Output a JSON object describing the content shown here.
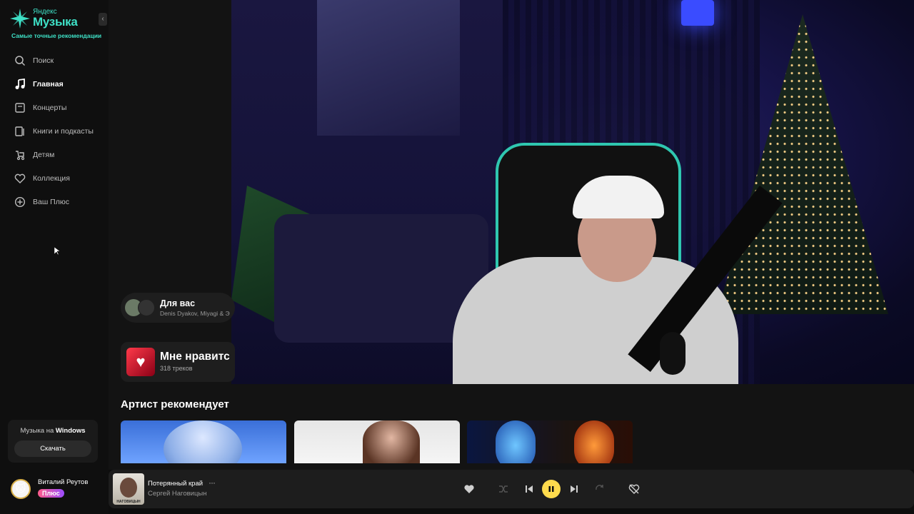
{
  "brand": {
    "small": "Яндекс",
    "big": "Музыка",
    "tagline": "Самые точные рекомендации",
    "accent_color": "#3ee0c6"
  },
  "sidebar": {
    "collapse_icon": "chevron-left-icon",
    "items": [
      {
        "label": "Поиск",
        "icon": "search-icon",
        "active": false
      },
      {
        "label": "Главная",
        "icon": "music-note-icon",
        "active": true
      },
      {
        "label": "Концерты",
        "icon": "ticket-icon",
        "active": false
      },
      {
        "label": "Книги и подкасты",
        "icon": "book-icon",
        "active": false
      },
      {
        "label": "Детям",
        "icon": "stroller-icon",
        "active": false
      },
      {
        "label": "Коллекция",
        "icon": "heart-icon",
        "active": false
      },
      {
        "label": "Ваш Плюс",
        "icon": "plus-circle-icon",
        "active": false
      }
    ],
    "windows_card": {
      "text_prefix": "Музыка на ",
      "text_bold": "Windows",
      "button": "Скачать"
    },
    "user": {
      "name": "Виталий Реутов",
      "badge": "Плюс",
      "avatar_icon": "cat-icon"
    }
  },
  "main": {
    "for_you": {
      "title": "Для вас",
      "subtitle": "Denis Dyakov, Miyagi & Э"
    },
    "liked": {
      "title": "Мне нравитс",
      "subtitle": "318 треков"
    },
    "artist_recommends": {
      "title": "Артист рекомендует"
    }
  },
  "player": {
    "track_title": "Потерянный край",
    "artist": "Сергей Наговицын",
    "cover_text": "НАГОВИЦЫН",
    "more_label": "···",
    "state": "playing",
    "play_color": "#ffdb4d"
  }
}
